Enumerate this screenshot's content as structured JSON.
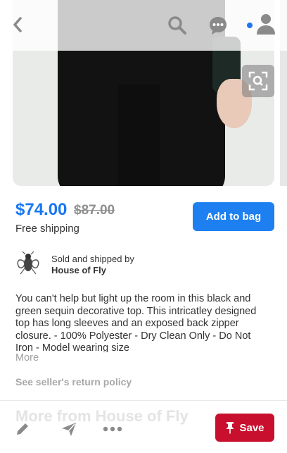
{
  "product": {
    "price": "$74.00",
    "original_price": "$87.00",
    "shipping": "Free shipping",
    "add_to_bag_label": "Add to bag"
  },
  "seller": {
    "sold_by_text": "Sold and shipped by",
    "name": "House of Fly"
  },
  "description": {
    "text": "You can't help but light up the room in this black and green sequin decorative top. This intricatley designed top has long sleeves and an exposed back zipper closure. - 100% Polyester - Dry Clean Only - Do Not Iron - Model wearing size",
    "more_label": "More"
  },
  "return_policy_label": "See seller's return policy",
  "more_from_heading": "More from House of Fly",
  "actions": {
    "save_label": "Save"
  },
  "icons": {
    "back": "chevron-left-icon",
    "search": "search-icon",
    "chat": "chat-bubble-icon",
    "profile": "user-icon",
    "lens": "visual-search-icon",
    "edit": "pencil-icon",
    "send": "send-icon",
    "more": "more-dots-icon",
    "pin": "pin-icon"
  },
  "colors": {
    "accent": "#1e80f0",
    "price": "#1877f2",
    "save": "#c8102e",
    "notification": "#1e77f0"
  }
}
